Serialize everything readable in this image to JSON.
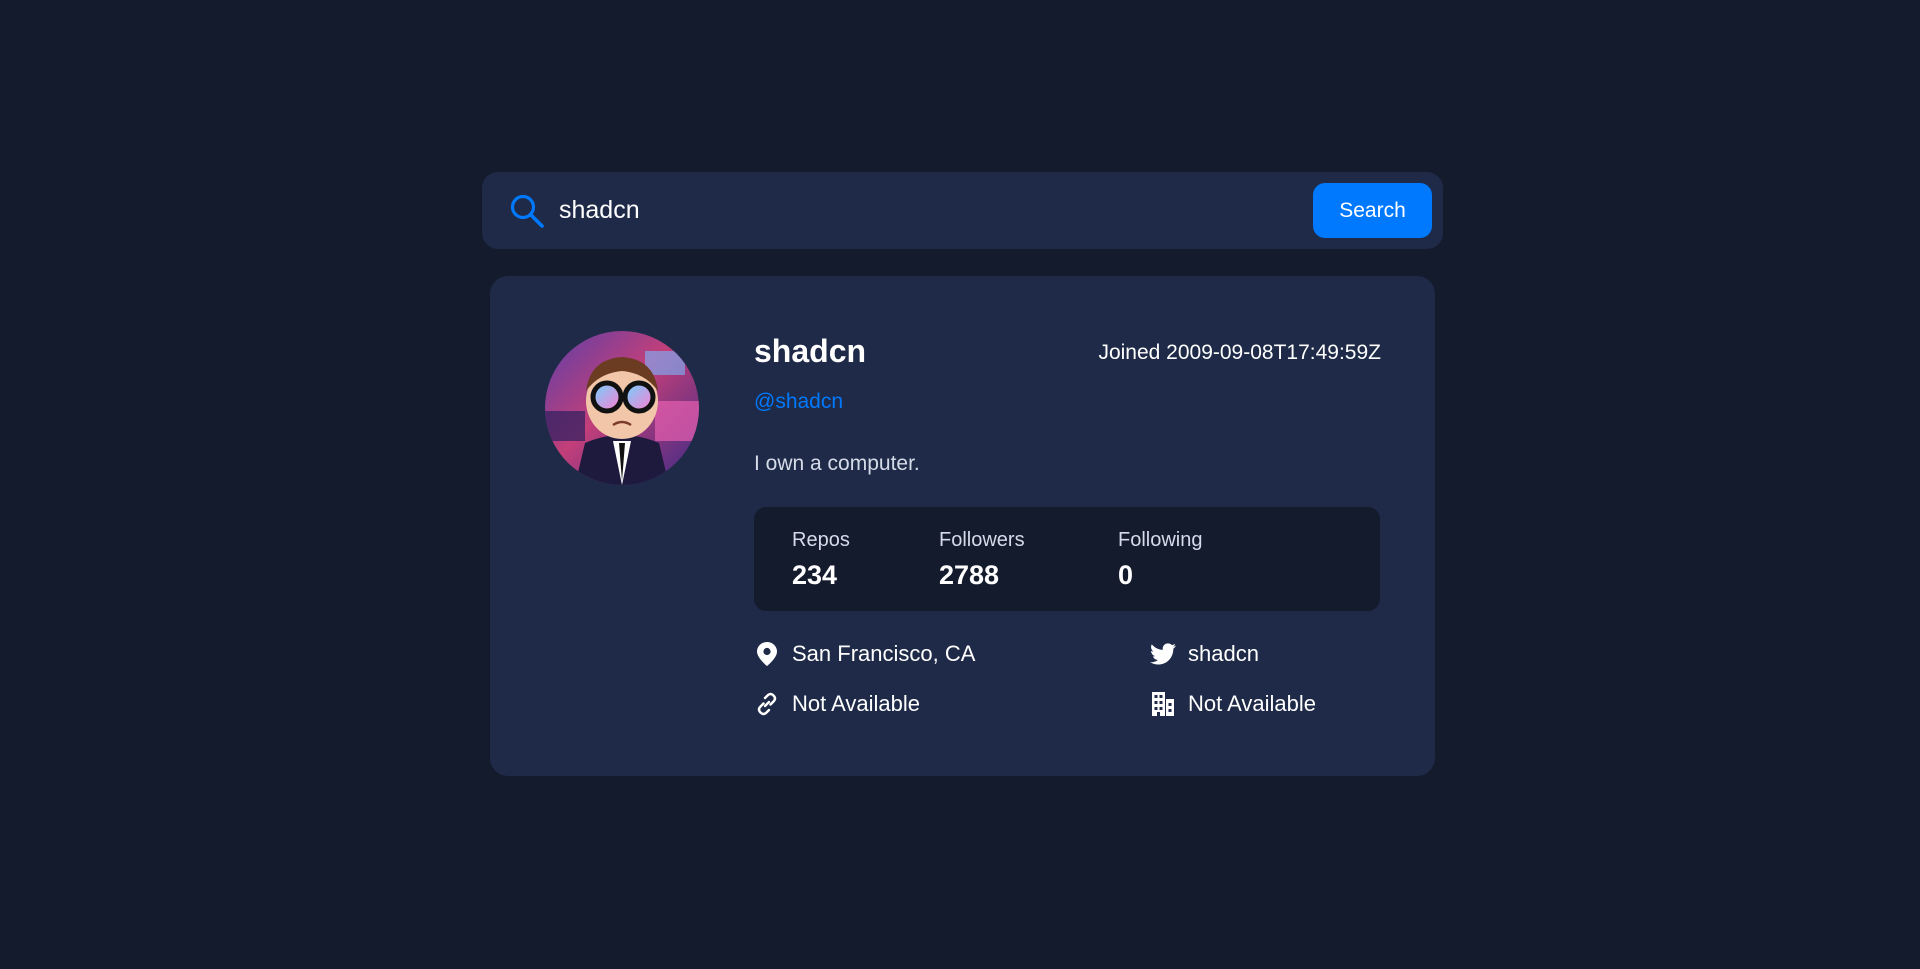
{
  "colors": {
    "background": "#141b2d",
    "card": "#1e2a47",
    "accent": "#0079ff",
    "stats_background": "#141b2d",
    "text": "#ffffff",
    "muted_text": "#d5dbe8"
  },
  "search": {
    "icon": "search-icon",
    "value": "shadcn",
    "button_label": "Search"
  },
  "profile": {
    "avatar": "avatar-image",
    "name": "shadcn",
    "joined": "Joined 2009-09-08T17:49:59Z",
    "login": "@shadcn",
    "bio": "I own a computer.",
    "stats": {
      "repos_label": "Repos",
      "repos": "234",
      "followers_label": "Followers",
      "followers": "2788",
      "following_label": "Following",
      "following": "0"
    },
    "links": {
      "location_icon": "location-pin-icon",
      "location": "San Francisco, CA",
      "blog_icon": "link-icon",
      "blog": "Not Available",
      "twitter_icon": "twitter-icon",
      "twitter": "shadcn",
      "company_icon": "building-icon",
      "company": "Not Available"
    }
  }
}
